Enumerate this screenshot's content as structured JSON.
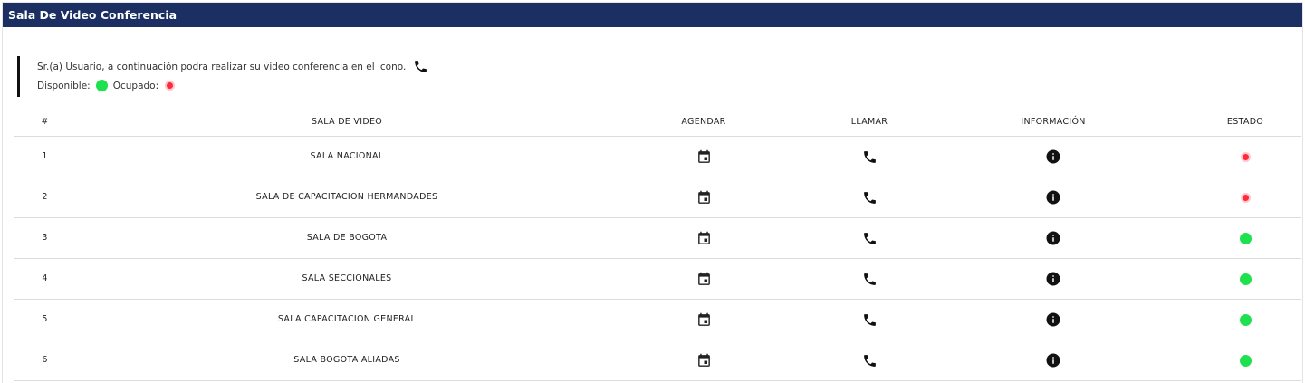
{
  "panel": {
    "title": "Sala De Video Conferencia"
  },
  "notice": {
    "line1": "Sr.(a) Usuario, a continuación podra realizar su video conferencia en el icono.",
    "phone_icon": "phone-icon",
    "available_label": "Disponible:",
    "busy_label": "Ocupado:"
  },
  "colors": {
    "header_bg": "#1b2f63",
    "available": "#1fe04f",
    "busy": "#ff2a3a"
  },
  "table": {
    "columns": [
      "#",
      "SALA DE VIDEO",
      "AGENDAR",
      "LLAMAR",
      "INFORMACIÓN",
      "ESTADO"
    ],
    "action_icons": {
      "agendar": "calendar-icon",
      "llamar": "phone-icon",
      "informacion": "info-icon"
    },
    "rows": [
      {
        "num": "1",
        "sala": "SALA NACIONAL",
        "estado": "busy"
      },
      {
        "num": "2",
        "sala": "SALA DE CAPACITACION HERMANDADES",
        "estado": "busy"
      },
      {
        "num": "3",
        "sala": "SALA DE BOGOTA",
        "estado": "available"
      },
      {
        "num": "4",
        "sala": "SALA SECCIONALES",
        "estado": "available"
      },
      {
        "num": "5",
        "sala": "SALA CAPACITACION GENERAL",
        "estado": "available"
      },
      {
        "num": "6",
        "sala": "SALA BOGOTA ALIADAS",
        "estado": "available"
      }
    ]
  }
}
